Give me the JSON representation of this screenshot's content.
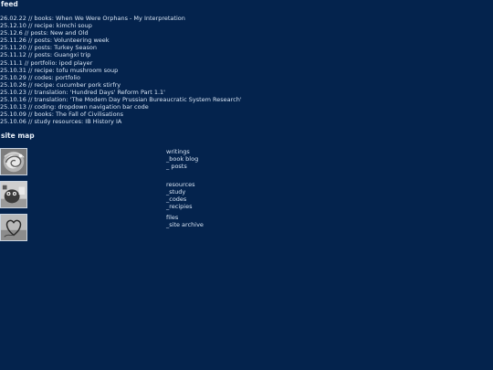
{
  "feed": {
    "heading": "feed",
    "items": [
      "26.02.22 // books: When We Were Orphans - My Interpretation",
      "25.12.10 // recipe: kimchi soup",
      "25.12.6 // posts: New and Old",
      "25.11.26 // posts: Volunteering week",
      "25.11.20 // posts: Turkey Season",
      "25.11.12 // posts: Guangxi trip",
      "25.11.1 // portfolio: ipod player",
      "25.10.31 // recipe: tofu mushroom soup",
      "25.10.29 // codes: portfolio",
      "25.10.26 // recipe: cucumber pork stirfry",
      "25.10.23 // translation: 'Hundred Days' Reform Part 1.1'",
      "25.10.16 // translation: 'The Modern Day Prussian Bureaucratic System Research'",
      "25.10.13 // coding: dropdown navigation bar code",
      "25.10.09 // books: The Fall of Civilisations",
      "25.10.06 // study resources: IB History IA"
    ]
  },
  "sitemap": {
    "heading": "site map",
    "groups": [
      {
        "links": [
          "writings",
          "_book blog",
          "_ posts"
        ]
      },
      {
        "links": [
          "resources",
          "_study",
          "_codes",
          "_recipies"
        ]
      },
      {
        "links": [
          "files",
          "_site archive"
        ]
      }
    ]
  },
  "colors": {
    "background": "#04234d",
    "text": "#d7e4f4"
  }
}
